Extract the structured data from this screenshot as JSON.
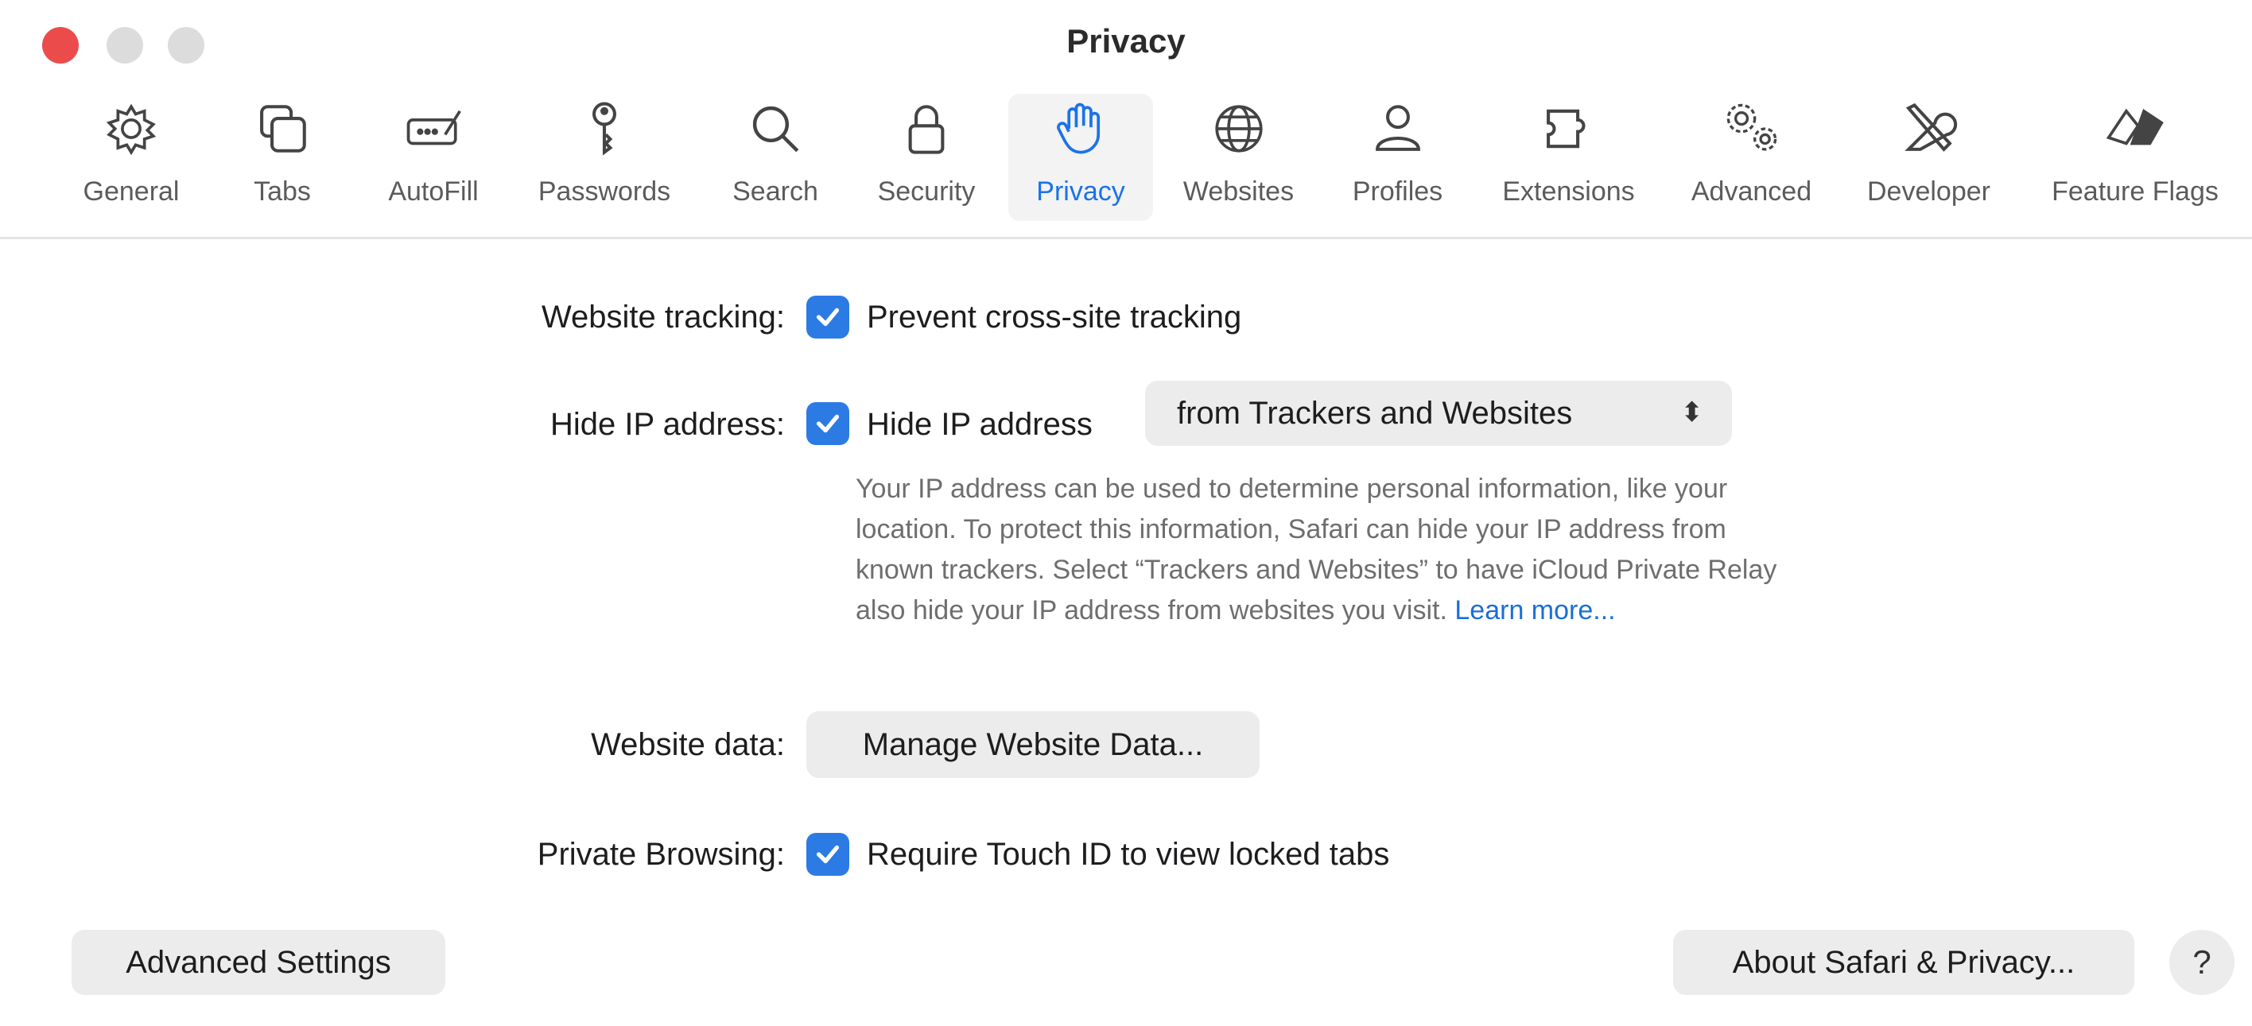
{
  "window": {
    "title": "Privacy"
  },
  "toolbar": {
    "tabs": [
      {
        "label": "General",
        "icon": "gear-icon"
      },
      {
        "label": "Tabs",
        "icon": "tabs-icon"
      },
      {
        "label": "AutoFill",
        "icon": "autofill-icon"
      },
      {
        "label": "Passwords",
        "icon": "key-icon"
      },
      {
        "label": "Search",
        "icon": "magnifier-icon"
      },
      {
        "label": "Security",
        "icon": "lock-icon"
      },
      {
        "label": "Privacy",
        "icon": "hand-icon",
        "active": true
      },
      {
        "label": "Websites",
        "icon": "globe-icon"
      },
      {
        "label": "Profiles",
        "icon": "person-icon"
      },
      {
        "label": "Extensions",
        "icon": "puzzle-icon"
      },
      {
        "label": "Advanced",
        "icon": "gears-icon"
      },
      {
        "label": "Developer",
        "icon": "tools-icon"
      },
      {
        "label": "Feature Flags",
        "icon": "flags-icon"
      }
    ]
  },
  "settings": {
    "website_tracking": {
      "label": "Website tracking:",
      "checkbox_label": "Prevent cross-site tracking",
      "checked": true
    },
    "hide_ip": {
      "label": "Hide IP address:",
      "checkbox_label": "Hide IP address",
      "checked": true,
      "select_value": "from Trackers and Websites",
      "help_text": "Your IP address can be used to determine personal information, like your location. To protect this information, Safari can hide your IP address from known trackers. Select “Trackers and Websites” to have iCloud Private Relay also hide your IP address from websites you visit.",
      "help_link": "Learn more..."
    },
    "website_data": {
      "label": "Website data:",
      "button_label": "Manage Website Data..."
    },
    "private_browsing": {
      "label": "Private Browsing:",
      "checkbox_label": "Require Touch ID to view locked tabs",
      "checked": true
    }
  },
  "footer": {
    "advanced_settings_label": "Advanced Settings",
    "about_label": "About Safari & Privacy...",
    "help_label": "?"
  },
  "colors": {
    "accent": "#2c7be5",
    "close": "#ec4b4b",
    "link": "#1a6ed8"
  }
}
